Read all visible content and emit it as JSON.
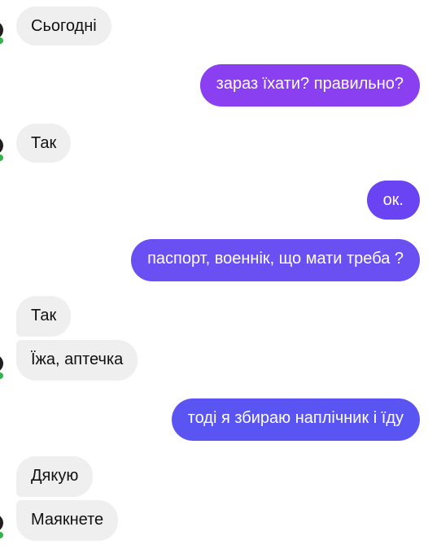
{
  "colors": {
    "incoming_bubble": "#efefef",
    "outgoing_purple": "#8a3ff0",
    "outgoing_indigo": "#6a4ff3",
    "outgoing_blue": "#5a55f2",
    "online_dot": "#31b44a"
  },
  "messages": [
    {
      "text": "Сьогодні"
    },
    {
      "text": "зараз їхати? правильно?"
    },
    {
      "text": "Так"
    },
    {
      "text": "ок."
    },
    {
      "text": "паспорт, военнік, що мати треба ?"
    },
    {
      "text": "Так"
    },
    {
      "text": "Їжа, аптечка"
    },
    {
      "text": "тоді я збираю наплічник і їду"
    },
    {
      "text": "Дякую"
    },
    {
      "text": "Маякнете"
    }
  ]
}
